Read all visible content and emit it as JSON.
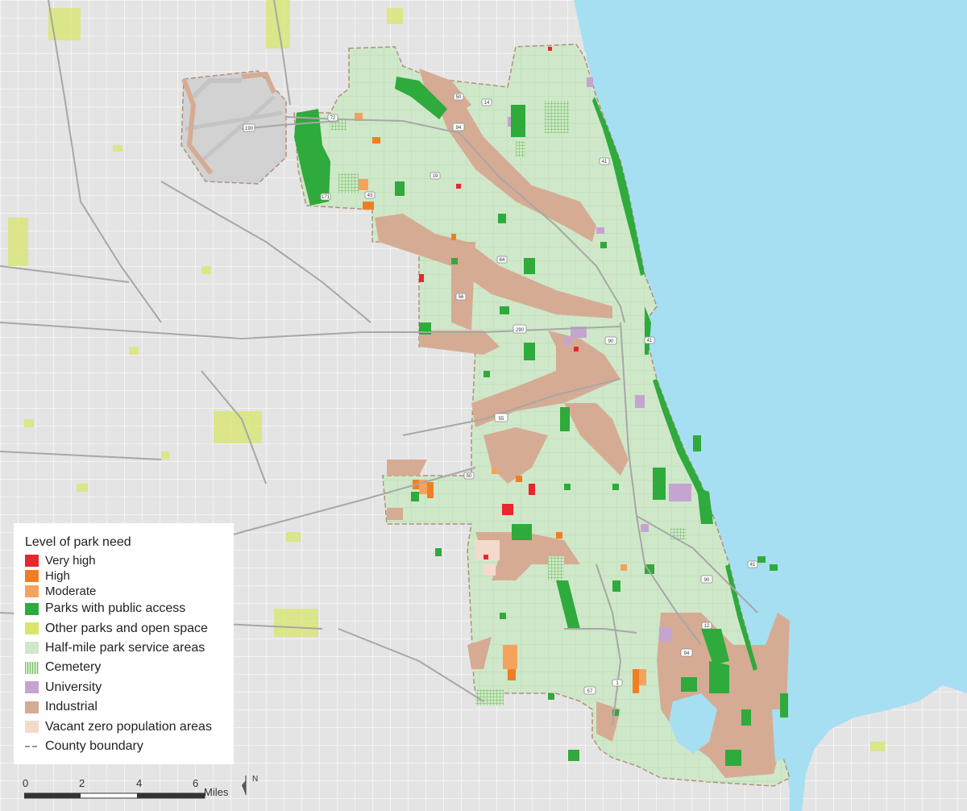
{
  "legend": {
    "title": "Level of park need",
    "items": [
      {
        "label": "Very high",
        "color": "#e8262e"
      },
      {
        "label": "High",
        "color": "#f07f24"
      },
      {
        "label": "Moderate",
        "color": "#f5a25d"
      },
      {
        "label": "Parks with public access",
        "color": "#2faa3c"
      },
      {
        "label": "Other parks and open space",
        "color": "#d9e66b"
      },
      {
        "label": "Half-mile park service areas",
        "color": "#cfe8c9"
      },
      {
        "label": "Cemetery",
        "color": "#9bd48c"
      },
      {
        "label": "University",
        "color": "#c5a4d2"
      },
      {
        "label": "Industrial",
        "color": "#d6ab94"
      },
      {
        "label": "Vacant zero population areas",
        "color": "#f4dacb"
      },
      {
        "label": "County boundary",
        "color": "#b08f7c"
      }
    ]
  },
  "scale": {
    "ticks": [
      "0",
      "2",
      "4",
      "6"
    ],
    "unit": "Miles"
  },
  "north_label": "N",
  "highway_shields": [
    "190",
    "72",
    "50",
    "14",
    "94",
    "19",
    "41",
    "171",
    "43",
    "64",
    "56",
    "290",
    "90",
    "41",
    "55",
    "50",
    "41",
    "90",
    "12",
    "94",
    "57",
    "1"
  ],
  "colors": {
    "lake": "#a6dff2",
    "land": "#e4e4e4",
    "roads": "#ffffff"
  }
}
